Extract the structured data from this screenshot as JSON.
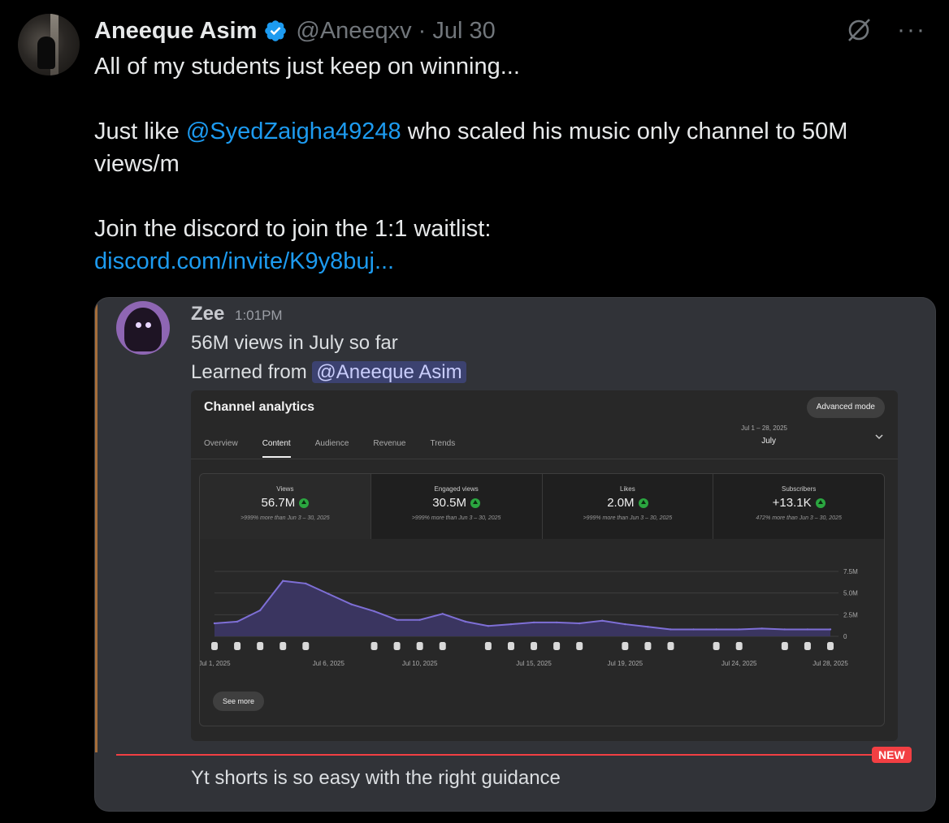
{
  "tweet": {
    "author_name": "Aneeque Asim",
    "handle": "@Aneeqxv",
    "separator": "·",
    "date": "Jul 30",
    "line1": "All of my students just keep on winning...",
    "line2_prefix": "Just like ",
    "line2_mention": "@SyedZaigha49248",
    "line2_suffix": " who scaled his music only channel to 50M",
    "line3": "views/m",
    "line4": "Join the discord to join the 1:1 waitlist:",
    "link": "discord.com/invite/K9y8buj...",
    "more_icon": "···"
  },
  "discord": {
    "username": "Zee",
    "time": "1:01PM",
    "message1": "56M views in July so far",
    "message2_prefix": "Learned from ",
    "message2_mention": "@Aneeque Asim",
    "new_badge": "NEW",
    "message3": "Yt shorts is so easy with the right guidance"
  },
  "analytics": {
    "title": "Channel analytics",
    "advanced_mode": "Advanced mode",
    "tabs": [
      "Overview",
      "Content",
      "Audience",
      "Revenue",
      "Trends"
    ],
    "active_tab": "Content",
    "date_range": "Jul 1 – 28, 2025",
    "date_label": "July",
    "see_more": "See more",
    "metrics": [
      {
        "label": "Views",
        "value": "56.7M",
        "comparison": ">999% more than Jun 3 – 30, 2025"
      },
      {
        "label": "Engaged views",
        "value": "30.5M",
        "comparison": ">999% more than Jun 3 – 30, 2025"
      },
      {
        "label": "Likes",
        "value": "2.0M",
        "comparison": ">999% more than Jun 3 – 30, 2025"
      },
      {
        "label": "Subscribers",
        "value": "+13.1K",
        "comparison": "472% more than Jun 3 – 30, 2025"
      }
    ]
  },
  "chart_data": {
    "type": "area",
    "x": [
      "Jul 1",
      "Jul 2",
      "Jul 3",
      "Jul 4",
      "Jul 5",
      "Jul 6",
      "Jul 7",
      "Jul 8",
      "Jul 9",
      "Jul 10",
      "Jul 11",
      "Jul 12",
      "Jul 13",
      "Jul 14",
      "Jul 15",
      "Jul 16",
      "Jul 17",
      "Jul 18",
      "Jul 19",
      "Jul 20",
      "Jul 21",
      "Jul 22",
      "Jul 23",
      "Jul 24",
      "Jul 25",
      "Jul 26",
      "Jul 27",
      "Jul 28"
    ],
    "series": [
      {
        "values": [
          1.5,
          1.7,
          3.0,
          6.4,
          6.1,
          4.9,
          3.7,
          2.9,
          1.9,
          1.9,
          2.6,
          1.7,
          1.2,
          1.4,
          1.6,
          1.6,
          1.5,
          1.8,
          1.4,
          1.1,
          0.8,
          0.8,
          0.8,
          0.8,
          0.9,
          0.8,
          0.8,
          0.8
        ]
      }
    ],
    "ylim": [
      0,
      7.5
    ],
    "y_ticks": [
      "0",
      "2.5M",
      "5.0M",
      "7.5M"
    ],
    "x_tick_labels": [
      {
        "i": 0,
        "label": "Jul 1, 2025"
      },
      {
        "i": 5,
        "label": "Jul 6, 2025"
      },
      {
        "i": 9,
        "label": "Jul 10, 2025"
      },
      {
        "i": 14,
        "label": "Jul 15, 2025"
      },
      {
        "i": 18,
        "label": "Jul 19, 2025"
      },
      {
        "i": 23,
        "label": "Jul 24, 2025"
      },
      {
        "i": 27,
        "label": "Jul 28, 2025"
      }
    ],
    "upload_markers_on": [
      0,
      1,
      2,
      3,
      4,
      7,
      8,
      9,
      10,
      12,
      13,
      14,
      15,
      16,
      18,
      19,
      20,
      22,
      23,
      25,
      26,
      27
    ],
    "colors": {
      "line": "#7e6fd6",
      "fill": "#3a3560",
      "grid": "#3e3e3e",
      "text": "#aaaaaa"
    },
    "grid": true
  }
}
